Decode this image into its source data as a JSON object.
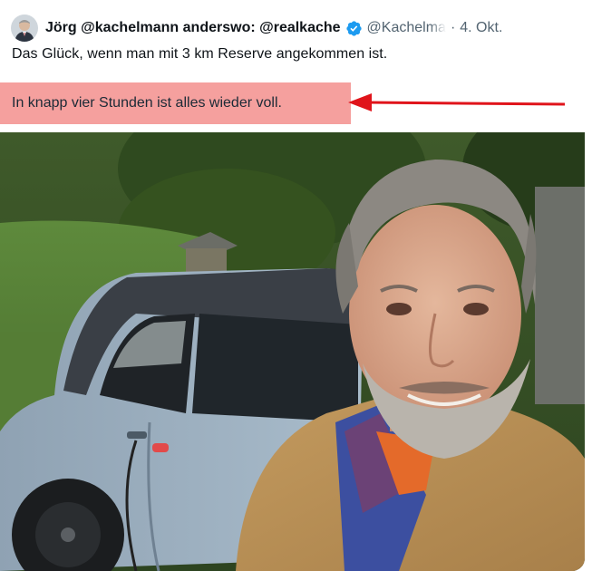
{
  "tweet": {
    "display_name": "Jörg @kachelmann anderswo: @realkache",
    "handle": "@Kachelma",
    "separator": "·",
    "date": "4. Okt.",
    "text": "Das Glück, wenn man mit 3 km Reserve angekommen ist."
  },
  "annotation": {
    "highlight_text": "In knapp vier Stunden ist alles wieder voll.",
    "highlight_color": "#f5a09e",
    "arrow_color": "#e0141b"
  },
  "icons": {
    "verified": "verified-badge-icon"
  },
  "colors": {
    "verified_blue": "#1d9bf0",
    "secondary_text": "#536471",
    "primary_text": "#0f1419"
  }
}
